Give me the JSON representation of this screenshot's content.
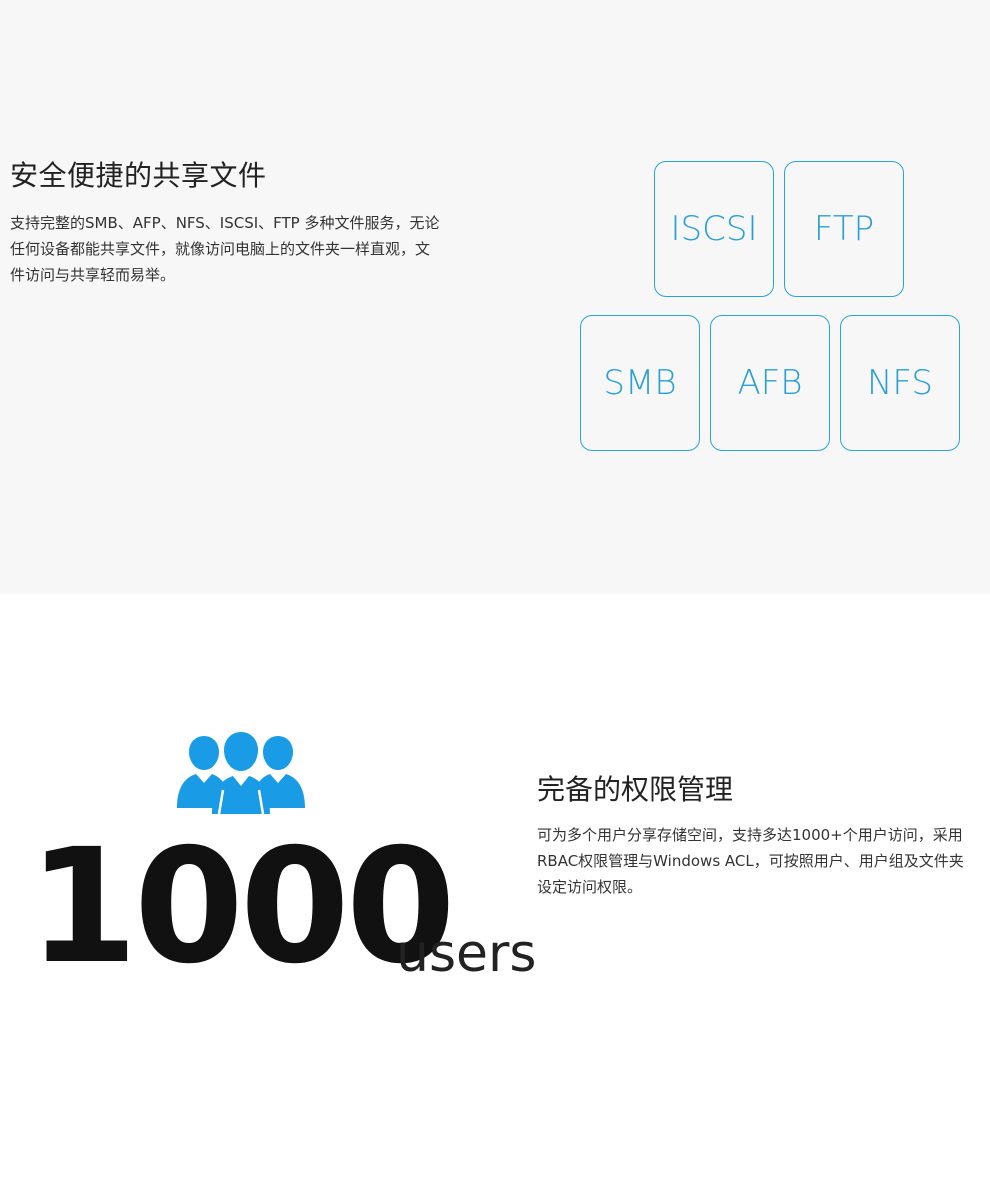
{
  "share": {
    "title": "安全便捷的共享文件",
    "description": "支持完整的SMB、AFP、NFS、ISCSI、FTP 多种文件服务，无论任何设备都能共享文件，就像访问电脑上的文件夹一样直观，文件访问与共享轻而易举。",
    "protocols": [
      "ISCSI",
      "FTP",
      "SMB",
      "AFB",
      "NFS"
    ],
    "accent_color": "#2aa3d6"
  },
  "permissions": {
    "icon": "users-group-icon",
    "icon_color": "#1a9be6",
    "number": "1000",
    "unit": "users",
    "title": "完备的权限管理",
    "description": "可为多个用户分享存储空间，支持多达1000+个用户访问，采用RBAC权限管理与Windows ACL，可按照用户、用户组及文件夹设定访问权限。"
  }
}
